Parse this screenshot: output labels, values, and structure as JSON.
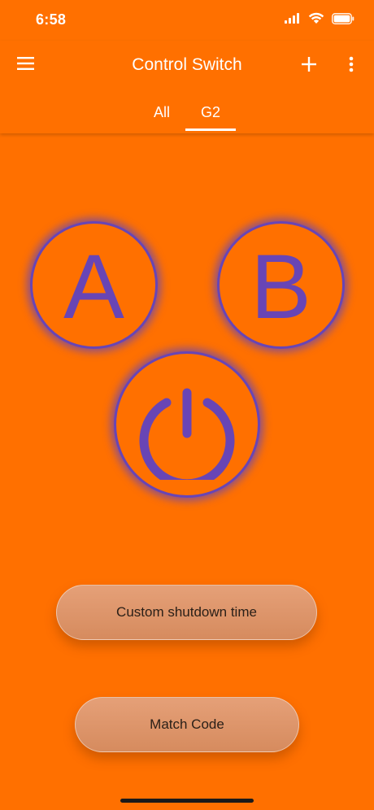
{
  "status_bar": {
    "time": "6:58",
    "icons": [
      "signal-icon",
      "wifi-icon",
      "battery-icon"
    ]
  },
  "app_bar": {
    "title": "Control Switch",
    "icons": [
      "menu-icon",
      "add-icon",
      "more-vert-icon"
    ]
  },
  "tabs": [
    {
      "label": "All",
      "selected": false
    },
    {
      "label": "G2",
      "selected": true
    }
  ],
  "controls": {
    "button_a": "A",
    "button_b": "B",
    "power_icon": "power-icon"
  },
  "actions": {
    "custom_shutdown_label": "Custom shutdown time",
    "match_code_label": "Match Code"
  },
  "colors": {
    "background": "#FF7000",
    "accent": "#6845B5",
    "pill": "#DE9468",
    "pill_text": "#2b2018"
  }
}
